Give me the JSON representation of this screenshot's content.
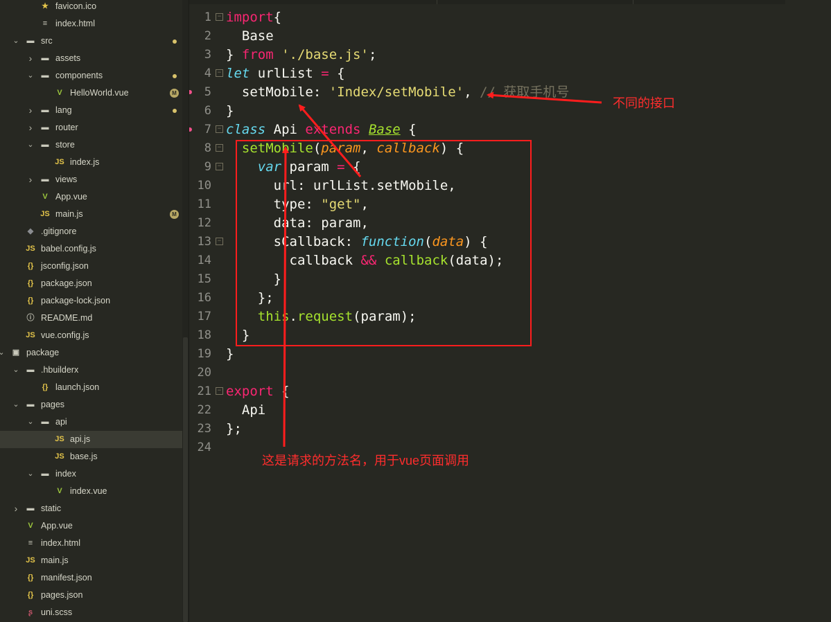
{
  "file_tree": [
    {
      "label": "favicon.ico",
      "indent": 80,
      "icon": "star-icon",
      "glyph": "★",
      "cls": "ic-star",
      "chevron": null
    },
    {
      "label": "index.html",
      "indent": 80,
      "icon": "html-file-icon",
      "glyph": "≡",
      "cls": "ic-html",
      "chevron": null
    },
    {
      "label": "src",
      "indent": 59,
      "icon": "folder-icon",
      "glyph": "▬",
      "cls": "ic-folder",
      "chevron": "down",
      "dot": true
    },
    {
      "label": "assets",
      "indent": 80,
      "icon": "folder-icon",
      "glyph": "▬",
      "cls": "ic-folder",
      "chevron": "right"
    },
    {
      "label": "components",
      "indent": 80,
      "icon": "folder-icon",
      "glyph": "▬",
      "cls": "ic-folder",
      "chevron": "down",
      "dot": true
    },
    {
      "label": "HelloWorld.vue",
      "indent": 101,
      "icon": "vue-file-icon",
      "glyph": "V",
      "cls": "ic-vue",
      "chevron": null,
      "badge": "M"
    },
    {
      "label": "lang",
      "indent": 80,
      "icon": "folder-icon",
      "glyph": "▬",
      "cls": "ic-folder",
      "chevron": "right",
      "dot": true
    },
    {
      "label": "router",
      "indent": 80,
      "icon": "folder-icon",
      "glyph": "▬",
      "cls": "ic-folder",
      "chevron": "right"
    },
    {
      "label": "store",
      "indent": 80,
      "icon": "folder-icon",
      "glyph": "▬",
      "cls": "ic-folder",
      "chevron": "down"
    },
    {
      "label": "index.js",
      "indent": 101,
      "icon": "js-file-icon",
      "glyph": "JS",
      "cls": "ic-js",
      "chevron": null
    },
    {
      "label": "views",
      "indent": 80,
      "icon": "folder-icon",
      "glyph": "▬",
      "cls": "ic-folder",
      "chevron": "right"
    },
    {
      "label": "App.vue",
      "indent": 80,
      "icon": "vue-file-icon",
      "glyph": "V",
      "cls": "ic-vue",
      "chevron": null
    },
    {
      "label": "main.js",
      "indent": 80,
      "icon": "js-file-icon",
      "glyph": "JS",
      "cls": "ic-js",
      "chevron": null,
      "badge": "M"
    },
    {
      "label": ".gitignore",
      "indent": 59,
      "icon": "git-file-icon",
      "glyph": "◆",
      "cls": "ic-git",
      "chevron": null
    },
    {
      "label": "babel.config.js",
      "indent": 59,
      "icon": "js-file-icon",
      "glyph": "JS",
      "cls": "ic-js",
      "chevron": null
    },
    {
      "label": "jsconfig.json",
      "indent": 59,
      "icon": "json-file-icon",
      "glyph": "{}",
      "cls": "ic-json",
      "chevron": null
    },
    {
      "label": "package.json",
      "indent": 59,
      "icon": "json-file-icon",
      "glyph": "{}",
      "cls": "ic-json",
      "chevron": null
    },
    {
      "label": "package-lock.json",
      "indent": 59,
      "icon": "json-file-icon",
      "glyph": "{}",
      "cls": "ic-json",
      "chevron": null
    },
    {
      "label": "README.md",
      "indent": 59,
      "icon": "info-file-icon",
      "glyph": "ⓘ",
      "cls": "ic-info",
      "chevron": null
    },
    {
      "label": "vue.config.js",
      "indent": 59,
      "icon": "js-file-icon",
      "glyph": "JS",
      "cls": "ic-js",
      "chevron": null
    },
    {
      "label": "package",
      "indent": 38,
      "icon": "project-icon",
      "glyph": "▣",
      "cls": "ic-pkg",
      "chevron": "down"
    },
    {
      "label": ".hbuilderx",
      "indent": 59,
      "icon": "folder-icon",
      "glyph": "▬",
      "cls": "ic-folder",
      "chevron": "down"
    },
    {
      "label": "launch.json",
      "indent": 80,
      "icon": "json-file-icon",
      "glyph": "{}",
      "cls": "ic-json",
      "chevron": null
    },
    {
      "label": "pages",
      "indent": 59,
      "icon": "folder-icon",
      "glyph": "▬",
      "cls": "ic-folder",
      "chevron": "down"
    },
    {
      "label": "api",
      "indent": 80,
      "icon": "folder-icon",
      "glyph": "▬",
      "cls": "ic-folder",
      "chevron": "down"
    },
    {
      "label": "api.js",
      "indent": 101,
      "icon": "js-file-icon",
      "glyph": "JS",
      "cls": "ic-js",
      "chevron": null,
      "selected": true
    },
    {
      "label": "base.js",
      "indent": 101,
      "icon": "js-file-icon",
      "glyph": "JS",
      "cls": "ic-js",
      "chevron": null
    },
    {
      "label": "index",
      "indent": 80,
      "icon": "folder-icon",
      "glyph": "▬",
      "cls": "ic-folder",
      "chevron": "down"
    },
    {
      "label": "index.vue",
      "indent": 101,
      "icon": "vue-file-icon",
      "glyph": "V",
      "cls": "ic-vue",
      "chevron": null
    },
    {
      "label": "static",
      "indent": 59,
      "icon": "folder-icon",
      "glyph": "▬",
      "cls": "ic-folder",
      "chevron": "right"
    },
    {
      "label": "App.vue",
      "indent": 59,
      "icon": "vue-file-icon",
      "glyph": "V",
      "cls": "ic-vue",
      "chevron": null
    },
    {
      "label": "index.html",
      "indent": 59,
      "icon": "html-file-icon",
      "glyph": "≡",
      "cls": "ic-html",
      "chevron": null
    },
    {
      "label": "main.js",
      "indent": 59,
      "icon": "js-file-icon",
      "glyph": "JS",
      "cls": "ic-js",
      "chevron": null
    },
    {
      "label": "manifest.json",
      "indent": 59,
      "icon": "json-file-icon",
      "glyph": "{}",
      "cls": "ic-json",
      "chevron": null
    },
    {
      "label": "pages.json",
      "indent": 59,
      "icon": "json-file-icon",
      "glyph": "{}",
      "cls": "ic-json",
      "chevron": null
    },
    {
      "label": "uni.scss",
      "indent": 59,
      "icon": "sass-file-icon",
      "glyph": "ʂ",
      "cls": "ic-sass",
      "chevron": null
    }
  ],
  "code_lines": [
    {
      "n": "1",
      "fold": true,
      "tokens": [
        [
          "kw",
          "import"
        ],
        [
          "",
          "{"
        ]
      ]
    },
    {
      "n": "2",
      "tokens": [
        [
          "",
          "  Base"
        ]
      ]
    },
    {
      "n": "3",
      "tokens": [
        [
          "",
          "} "
        ],
        [
          "kw",
          "from"
        ],
        [
          "",
          " "
        ],
        [
          "str",
          "'./base.js'"
        ],
        [
          "",
          ";"
        ]
      ]
    },
    {
      "n": "4",
      "fold": true,
      "tokens": [
        [
          "kwi",
          "let"
        ],
        [
          "",
          " urlList "
        ],
        [
          "kw",
          "="
        ],
        [
          "",
          " {"
        ]
      ]
    },
    {
      "n": "5",
      "marker": true,
      "tokens": [
        [
          "",
          "  setMobile: "
        ],
        [
          "str",
          "'Index/setMobile'"
        ],
        [
          "",
          ", "
        ],
        [
          "cmt",
          "// 获取手机号"
        ]
      ]
    },
    {
      "n": "6",
      "tokens": [
        [
          "",
          "}"
        ]
      ]
    },
    {
      "n": "7",
      "fold": true,
      "marker": true,
      "tokens": [
        [
          "kwi",
          "class"
        ],
        [
          "",
          " Api "
        ],
        [
          "kw",
          "extends"
        ],
        [
          "",
          " "
        ],
        [
          "cls",
          "Base"
        ],
        [
          "",
          " {"
        ]
      ]
    },
    {
      "n": "8",
      "fold": true,
      "tokens": [
        [
          "",
          "  "
        ],
        [
          "fn",
          "setMobile"
        ],
        [
          "",
          "("
        ],
        [
          "par",
          "param"
        ],
        [
          "",
          ", "
        ],
        [
          "par",
          "callback"
        ],
        [
          "",
          ") {"
        ]
      ]
    },
    {
      "n": "9",
      "fold": true,
      "tokens": [
        [
          "",
          "    "
        ],
        [
          "kwi",
          "var"
        ],
        [
          "",
          " param "
        ],
        [
          "kw",
          "="
        ],
        [
          "",
          " {"
        ]
      ]
    },
    {
      "n": "10",
      "tokens": [
        [
          "",
          "      url: urlList.setMobile,"
        ]
      ]
    },
    {
      "n": "11",
      "tokens": [
        [
          "",
          "      type: "
        ],
        [
          "str",
          "\"get\""
        ],
        [
          "",
          ","
        ]
      ]
    },
    {
      "n": "12",
      "tokens": [
        [
          "",
          "      data: param,"
        ]
      ]
    },
    {
      "n": "13",
      "fold": true,
      "tokens": [
        [
          "",
          "      sCallback: "
        ],
        [
          "kwi",
          "function"
        ],
        [
          "",
          "("
        ],
        [
          "par",
          "data"
        ],
        [
          "",
          ") {"
        ]
      ]
    },
    {
      "n": "14",
      "tokens": [
        [
          "",
          "        callback "
        ],
        [
          "kw",
          "&&"
        ],
        [
          "",
          " "
        ],
        [
          "fn",
          "callback"
        ],
        [
          "",
          "(data);"
        ]
      ]
    },
    {
      "n": "15",
      "tokens": [
        [
          "",
          "      }"
        ]
      ]
    },
    {
      "n": "16",
      "tokens": [
        [
          "",
          "    };"
        ]
      ]
    },
    {
      "n": "17",
      "tokens": [
        [
          "",
          "    "
        ],
        [
          "fn",
          "this"
        ],
        [
          "",
          "."
        ],
        [
          "fn",
          "request"
        ],
        [
          "",
          "(param);"
        ]
      ]
    },
    {
      "n": "18",
      "tokens": [
        [
          "",
          "  }"
        ]
      ]
    },
    {
      "n": "19",
      "tokens": [
        [
          "",
          "}"
        ]
      ]
    },
    {
      "n": "20",
      "tokens": []
    },
    {
      "n": "21",
      "fold": true,
      "tokens": [
        [
          "kw",
          "export"
        ],
        [
          "",
          " {"
        ]
      ]
    },
    {
      "n": "22",
      "tokens": [
        [
          "",
          "  Api"
        ]
      ]
    },
    {
      "n": "23",
      "tokens": [
        [
          "",
          "};"
        ]
      ]
    },
    {
      "n": "24",
      "tokens": []
    }
  ],
  "annotations": {
    "interface_note": "不同的接口",
    "method_note": "这是请求的方法名，用于vue页面调用"
  },
  "colors": {
    "annotation": "#ff1d1d",
    "editor_bg": "#272822",
    "keyword": "#f92672",
    "string": "#e6db74",
    "function": "#a6e22e",
    "param": "#fd971f",
    "storage": "#66d9ef"
  }
}
